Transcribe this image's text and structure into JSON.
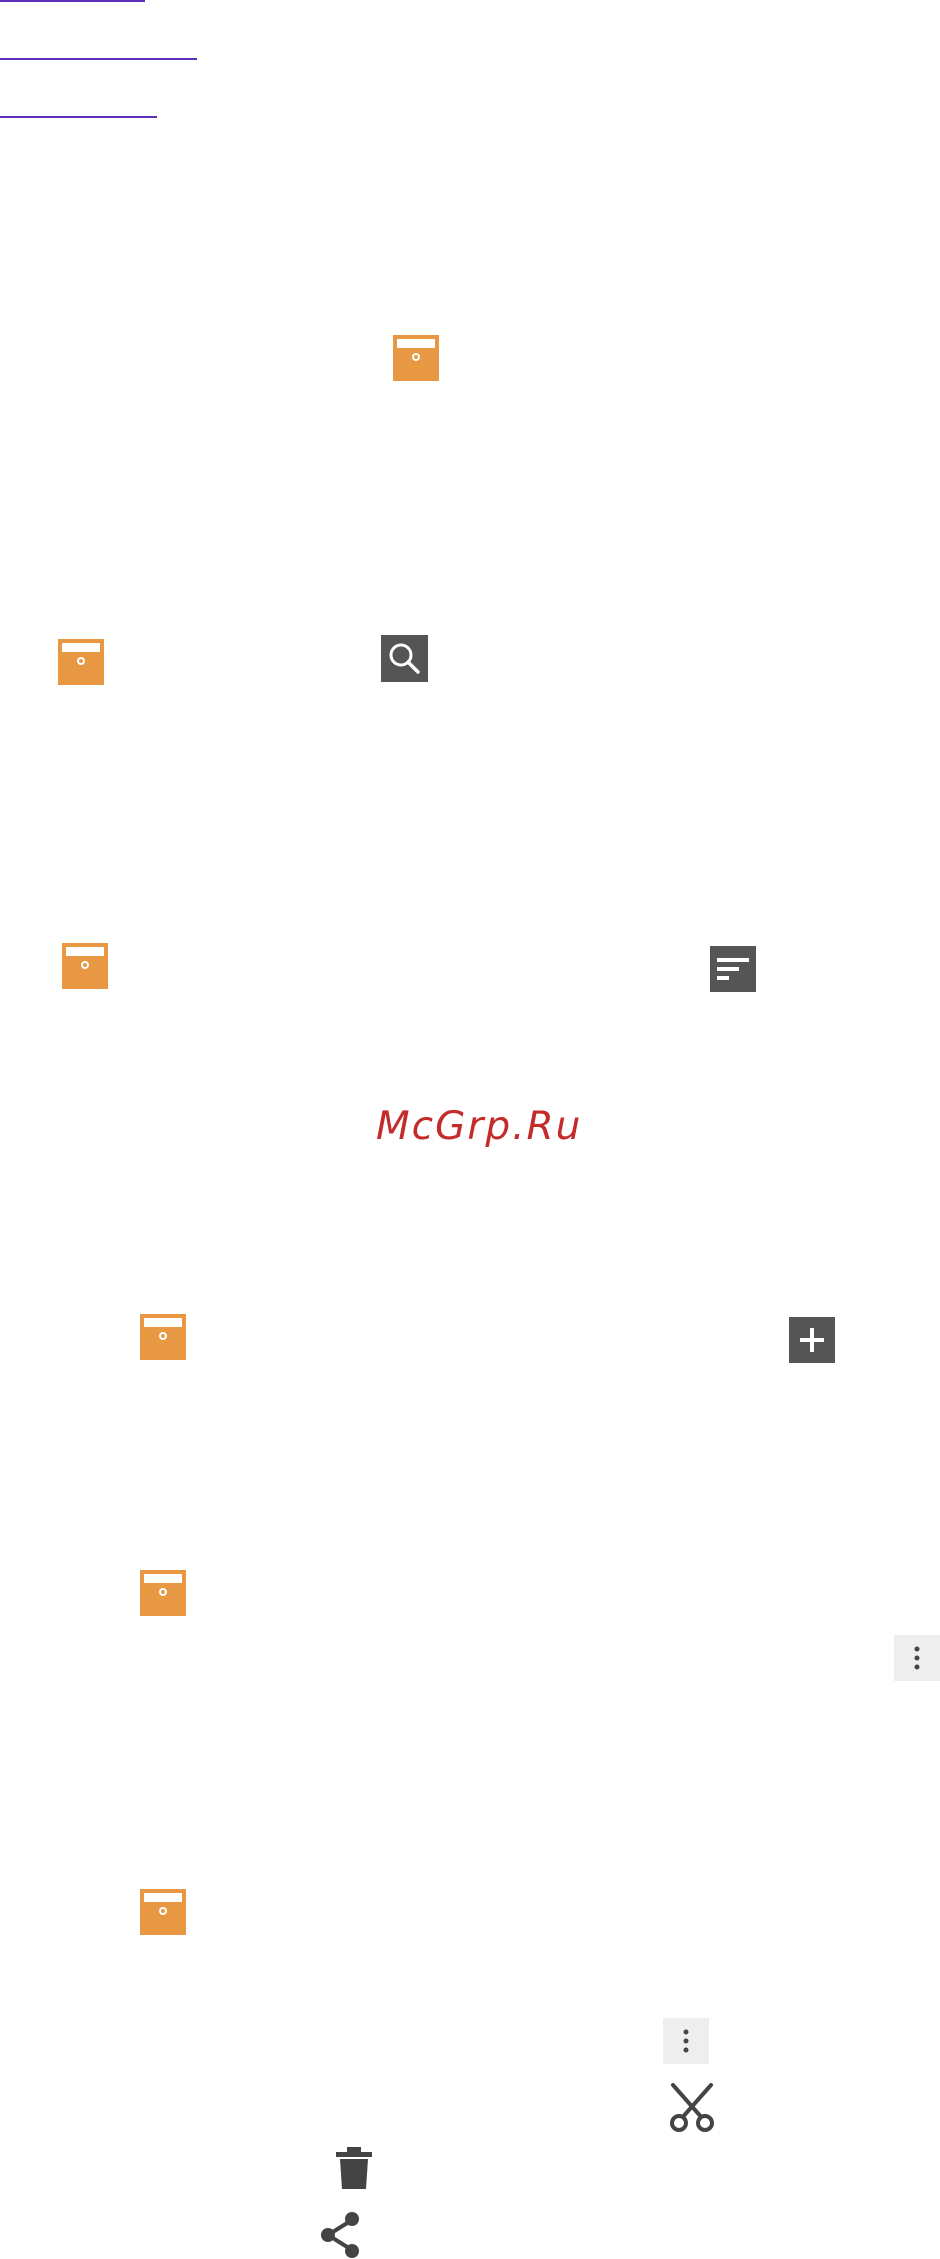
{
  "watermark": {
    "text": "McGrp.Ru"
  },
  "links": [
    {
      "name": "link-1"
    },
    {
      "name": "link-2"
    },
    {
      "name": "link-3"
    }
  ],
  "icons": {
    "archive": "archive-icon",
    "search": "search-icon",
    "sort": "sort-icon",
    "add": "add-icon",
    "more": "more-vert-icon",
    "cut": "cut-icon",
    "delete": "delete-icon",
    "share": "share-icon"
  },
  "colors": {
    "archive": "#e89843",
    "icon_dark": "#555555",
    "watermark": "#c42b2b",
    "link": "#5b2fb8"
  }
}
